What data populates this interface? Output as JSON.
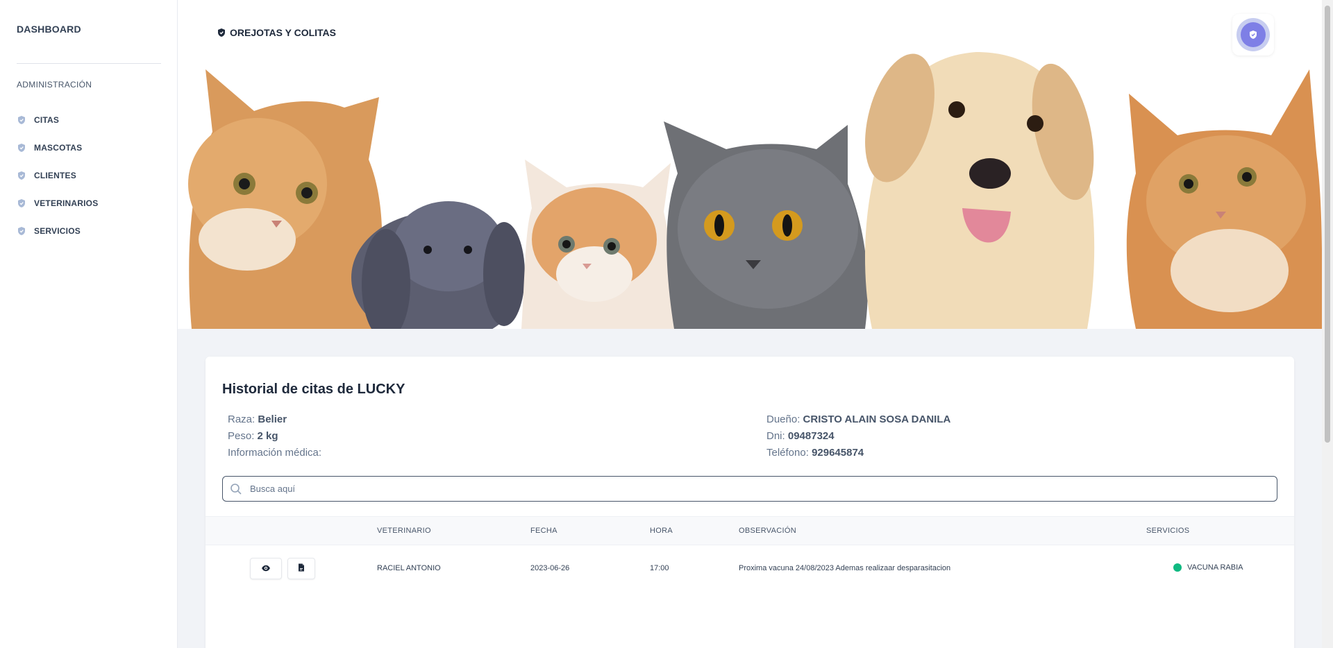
{
  "sidebar": {
    "brand": "DASHBOARD",
    "section_label": "ADMINISTRACIÓN",
    "items": [
      {
        "label": "CITAS",
        "icon": "shield-icon"
      },
      {
        "label": "MASCOTAS",
        "icon": "shield-icon"
      },
      {
        "label": "CLIENTES",
        "icon": "shield-icon"
      },
      {
        "label": "VETERINARIOS",
        "icon": "shield-icon"
      },
      {
        "label": "SERVICIOS",
        "icon": "shield-icon"
      }
    ]
  },
  "header": {
    "title": "OREJOTAS Y COLITAS",
    "title_icon": "shield-icon",
    "avatar_icon": "user-avatar-icon"
  },
  "hero": {
    "image_subject": "cats-rabbit-dog-banner"
  },
  "history": {
    "title_prefix": "Historial de citas de",
    "pet_name": "LUCKY",
    "left": [
      {
        "label": "Raza:",
        "value": "Belier"
      },
      {
        "label": "Peso:",
        "value": "2 kg"
      },
      {
        "label": "Información médica:",
        "value": ""
      }
    ],
    "right": [
      {
        "label": "Dueño:",
        "value": "CRISTO ALAIN SOSA DANILA"
      },
      {
        "label": "Dni:",
        "value": "09487324"
      },
      {
        "label": "Teléfono:",
        "value": "929645874"
      }
    ]
  },
  "search": {
    "placeholder": "Busca aquí",
    "value": ""
  },
  "table": {
    "headers": {
      "vet": "VETERINARIO",
      "date": "FECHA",
      "time": "HORA",
      "obs": "OBSERVACIÓN",
      "services": "SERVICIOS"
    },
    "rows": [
      {
        "vet": "RACIEL ANTONIO",
        "date": "2023-06-26",
        "time": "17:00",
        "obs": "Proxima vacuna 24/08/2023 Ademas realizaar desparasitacion",
        "service": "VACUNA RABIA",
        "service_status_color": "#10b981",
        "actions": [
          "eye-icon",
          "document-icon"
        ]
      }
    ]
  },
  "colors": {
    "accent": "#7e7fe6",
    "status_green": "#10b981",
    "text_dark": "#1e293b"
  }
}
